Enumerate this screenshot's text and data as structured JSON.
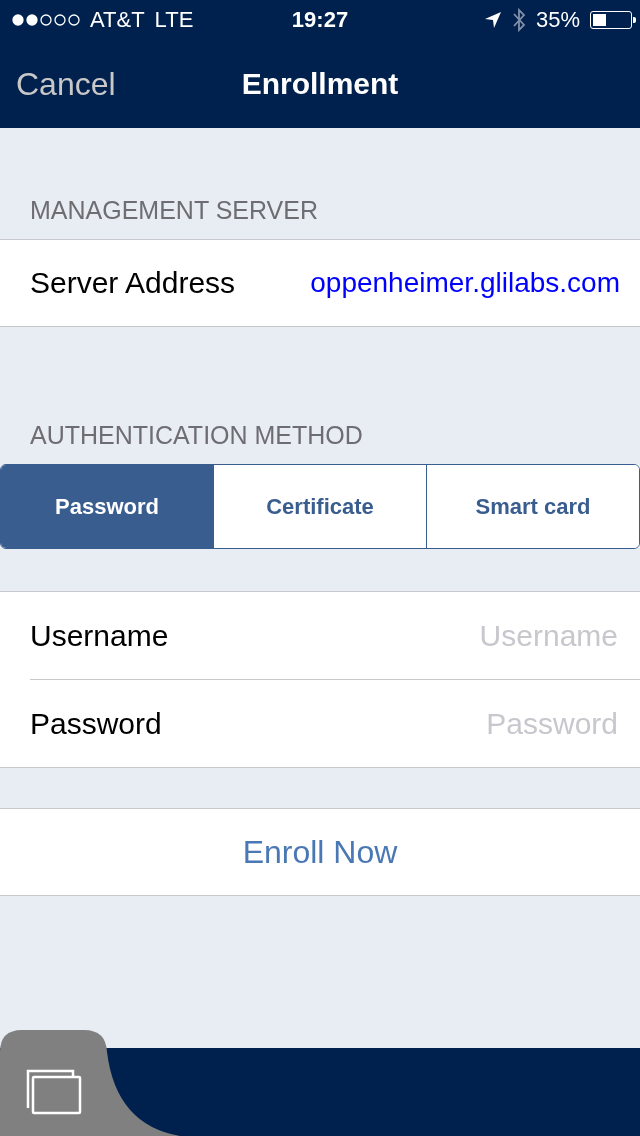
{
  "status_bar": {
    "carrier": "AT&T",
    "network": "LTE",
    "time": "19:27",
    "battery": "35%"
  },
  "nav": {
    "cancel": "Cancel",
    "title": "Enrollment"
  },
  "server_section": {
    "header": "MANAGEMENT SERVER",
    "label": "Server Address",
    "value": "oppenheimer.glilabs.com"
  },
  "auth_section": {
    "header": "AUTHENTICATION METHOD",
    "segments": [
      {
        "label": "Password",
        "selected": true
      },
      {
        "label": "Certificate",
        "selected": false
      },
      {
        "label": "Smart card",
        "selected": false
      }
    ]
  },
  "fields": [
    {
      "label": "Username",
      "placeholder": "Username"
    },
    {
      "label": "Password",
      "placeholder": "Password"
    }
  ],
  "enroll_button": "Enroll Now"
}
